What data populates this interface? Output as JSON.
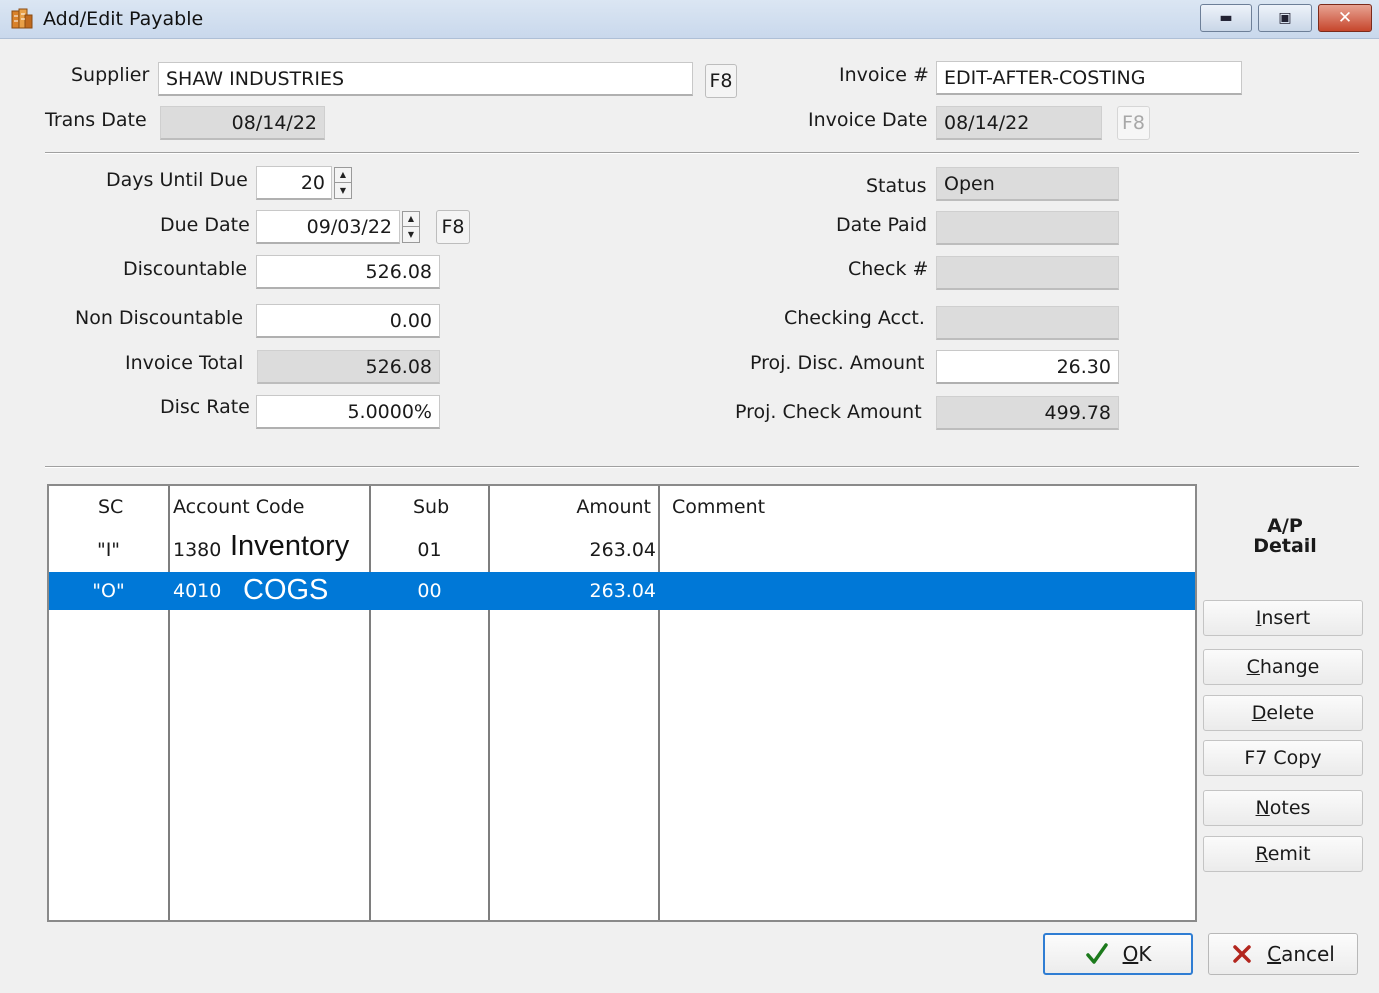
{
  "window": {
    "title": "Add/Edit Payable"
  },
  "header": {
    "supplier_label": "Supplier",
    "supplier_value": "SHAW INDUSTRIES",
    "supplier_lookup": "F8",
    "trans_date_label": "Trans Date",
    "trans_date_value": "08/14/22",
    "invoice_no_label": "Invoice #",
    "invoice_no_value": "EDIT-AFTER-COSTING",
    "invoice_date_label": "Invoice Date",
    "invoice_date_value": "08/14/22",
    "invoice_date_lookup": "F8"
  },
  "left": {
    "days_until_due_label": "Days Until Due",
    "days_until_due_value": "20",
    "due_date_label": "Due Date",
    "due_date_value": "09/03/22",
    "due_date_lookup": "F8",
    "discountable_label": "Discountable",
    "discountable_value": "526.08",
    "non_discountable_label": "Non Discountable",
    "non_discountable_value": "0.00",
    "invoice_total_label": "Invoice Total",
    "invoice_total_value": "526.08",
    "disc_rate_label": "Disc Rate",
    "disc_rate_value": "5.0000%"
  },
  "right": {
    "status_label": "Status",
    "status_value": "Open",
    "date_paid_label": "Date Paid",
    "date_paid_value": "",
    "check_no_label": "Check #",
    "check_no_value": "",
    "checking_acct_label": "Checking Acct.",
    "checking_acct_value": "",
    "proj_disc_label": "Proj. Disc. Amount",
    "proj_disc_value": "26.30",
    "proj_check_label": "Proj. Check Amount",
    "proj_check_value": "499.78"
  },
  "grid": {
    "columns": {
      "sc": "SC",
      "account": "Account Code",
      "sub": "Sub",
      "amount": "Amount",
      "comment": "Comment"
    },
    "rows": [
      {
        "sc": "\"I\"",
        "account": "1380",
        "annotation": "Inventory",
        "sub": "01",
        "amount": "263.04",
        "comment": ""
      },
      {
        "sc": "\"O\"",
        "account": "4010",
        "annotation": "COGS",
        "sub": "00",
        "amount": "263.04",
        "comment": ""
      }
    ]
  },
  "side": {
    "title_line1": "A/P",
    "title_line2": "Detail",
    "insert": {
      "first": "I",
      "rest": "nsert"
    },
    "change": {
      "first": "C",
      "rest": "hange"
    },
    "delete": {
      "first": "D",
      "rest": "elete"
    },
    "copy": "F7 Copy",
    "notes": {
      "first": "N",
      "rest": "otes"
    },
    "remit": {
      "first": "R",
      "rest": "emit"
    }
  },
  "footer": {
    "ok": {
      "first": "O",
      "rest": "K"
    },
    "cancel": {
      "first": "C",
      "rest": "ancel"
    }
  },
  "colors": {
    "selection": "#0078d7",
    "ok_border": "#2f7dd3",
    "cancel_x": "#b3261e"
  }
}
